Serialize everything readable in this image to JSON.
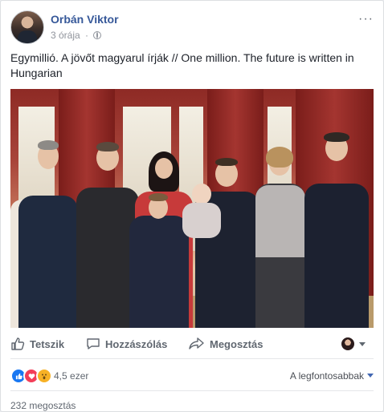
{
  "post": {
    "author": "Orbán Viktor",
    "time": "3 órája",
    "separator": "·",
    "text": "Egymillió. A jövőt magyarul írják // One million. The future is written in Hungarian",
    "more_icon": "···"
  },
  "actions": {
    "like_label": "Tetszik",
    "comment_label": "Hozzászólás",
    "share_label": "Megosztás"
  },
  "reactions": {
    "count": "4,5 ezer",
    "sort_label": "A legfontosabbak",
    "types": [
      "like",
      "love",
      "wow"
    ]
  },
  "shares": {
    "label": "232 megosztás"
  },
  "icons": {
    "privacy": "globe-icon",
    "like": "thumbs-up-icon",
    "comment": "comment-bubble-icon",
    "share": "share-arrow-icon"
  },
  "colors": {
    "link": "#365899",
    "secondary_text": "#90949c",
    "action_text": "#606770",
    "like_reaction": "#1877f2",
    "love_reaction": "#f33e58",
    "wow_reaction": "#f7b125"
  }
}
